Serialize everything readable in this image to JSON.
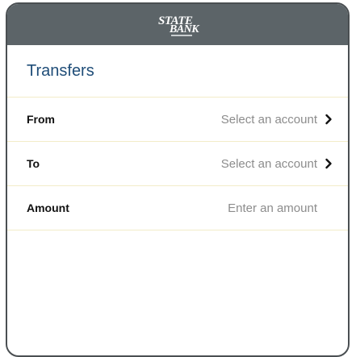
{
  "header": {
    "logo_line1": "STATE",
    "logo_line2": "BANK"
  },
  "page": {
    "title": "Transfers"
  },
  "form": {
    "from": {
      "label": "From",
      "value": "Select an account",
      "icon": "chevron-right-icon"
    },
    "to": {
      "label": "To",
      "value": "Select an account",
      "icon": "chevron-right-icon"
    },
    "amount": {
      "label": "Amount",
      "placeholder": "Enter an amount",
      "value": ""
    }
  },
  "colors": {
    "header_bg": "#5c6468",
    "title": "#1f4d78",
    "divider": "#f2ecc8",
    "muted_text": "#8c8c8c"
  }
}
